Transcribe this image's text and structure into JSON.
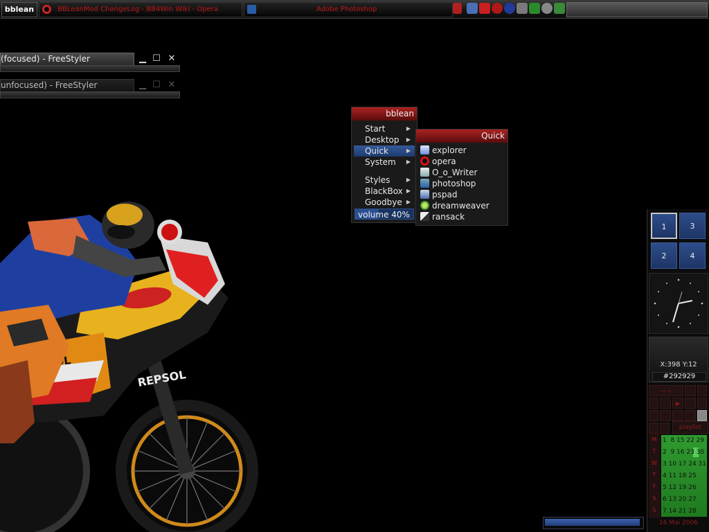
{
  "topbar": {
    "brand": "bblean",
    "tasks": [
      {
        "label": "BBLeanMod ChangeLog - BB4Win Wiki - Opera",
        "icon": "opera-icon"
      },
      {
        "label": "Adobe Photoshop",
        "icon": "photoshop-icon"
      }
    ],
    "tray_icons": [
      "arrow-left-icon",
      "network-icon",
      "network-alt-icon",
      "antivirus-icon",
      "opera-tray-icon",
      "radio-icon",
      "monitor-icon",
      "money-icon",
      "tools-icon",
      "update-icon"
    ]
  },
  "windows": [
    {
      "title": "(focused) - FreeStyler",
      "minimize": "▁",
      "maximize": "☐",
      "close": "✕"
    },
    {
      "title": "unfocused) - FreeStyler",
      "minimize": "▁",
      "maximize": "☐",
      "close": "✕"
    }
  ],
  "menu": {
    "title": "bblean",
    "items": [
      {
        "label": "Start",
        "has_submenu": true
      },
      {
        "label": "Desktop",
        "has_submenu": true
      },
      {
        "label": "Quick",
        "has_submenu": true,
        "selected": true
      },
      {
        "label": "System",
        "has_submenu": true
      },
      {
        "label": "Styles",
        "has_submenu": true
      },
      {
        "label": "BlackBox",
        "has_submenu": true
      },
      {
        "label": "Goodbye",
        "has_submenu": true
      }
    ],
    "volume_label": "volume 40%",
    "volume_level": 0.4
  },
  "quick": {
    "title": "Quick",
    "items": [
      {
        "label": "explorer",
        "icon": "explorer-icon"
      },
      {
        "label": "opera",
        "icon": "opera-icon"
      },
      {
        "label": "O_o_Writer",
        "icon": "writer-icon"
      },
      {
        "label": "photoshop",
        "icon": "photoshop-icon"
      },
      {
        "label": "pspad",
        "icon": "pspad-icon"
      },
      {
        "label": "dreamweaver",
        "icon": "dreamweaver-icon"
      },
      {
        "label": "ransack",
        "icon": "ransack-icon"
      }
    ]
  },
  "workspaces": [
    "1",
    "3",
    "2",
    "4"
  ],
  "coords": {
    "label": "X:398 Y:12",
    "color": "#292929"
  },
  "media": {
    "playlist_label": "playlist"
  },
  "calendar": {
    "day_letters": [
      "M",
      "T",
      "W",
      "T",
      "F",
      "S",
      "S"
    ],
    "rows": [
      "1  8 15 22 29",
      "2  9 16 23 30",
      "3 10 17 24 31",
      "4 11 18 25",
      "5 12 19 26",
      "6 13 20 27",
      "7 14 21 28"
    ],
    "date_label": "16 Mai 2006"
  },
  "progress": {
    "level": 0.98
  },
  "colors": {
    "accent_red": "#a22222",
    "accent_blue": "#2d4d8a",
    "calendar_green": "#2f9a2f"
  }
}
